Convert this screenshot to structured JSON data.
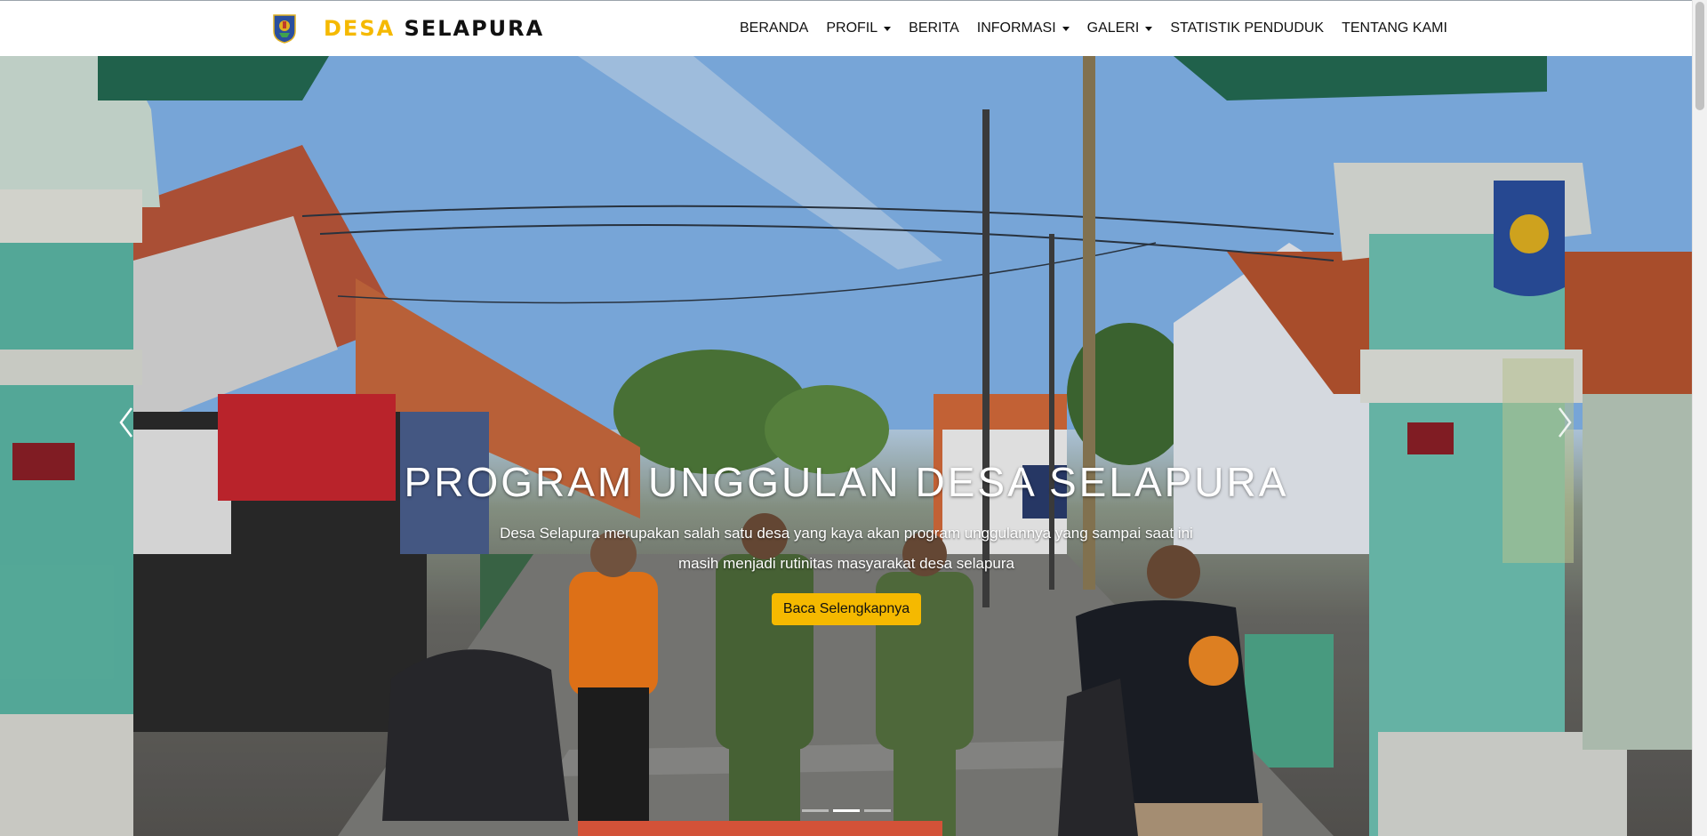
{
  "brand": {
    "name_accent": "DESA",
    "name_rest": "SELAPURA",
    "logo_icon": "village-emblem-icon"
  },
  "nav": {
    "items": [
      {
        "label": "BERANDA",
        "dropdown": false
      },
      {
        "label": "PROFIL",
        "dropdown": true
      },
      {
        "label": "BERITA",
        "dropdown": false
      },
      {
        "label": "INFORMASI",
        "dropdown": true
      },
      {
        "label": "GALERI",
        "dropdown": true
      },
      {
        "label": "STATISTIK PENDUDUK",
        "dropdown": false
      },
      {
        "label": "TENTANG KAMI",
        "dropdown": false
      }
    ]
  },
  "hero": {
    "title": "PROGRAM UNGGULAN DESA SELAPURA",
    "description": "Desa Selapura merupakan salah satu desa yang kaya akan program unggulannya yang sampai saat ini masih menjadi rutinitas masyarakat desa selapura",
    "button_label": "Baca Selengkapnya",
    "prev_icon": "chevron-left-icon",
    "next_icon": "chevron-right-icon",
    "slides_total": 3,
    "active_slide": 2
  },
  "colors": {
    "accent": "#f5b900",
    "text": "#111111"
  }
}
